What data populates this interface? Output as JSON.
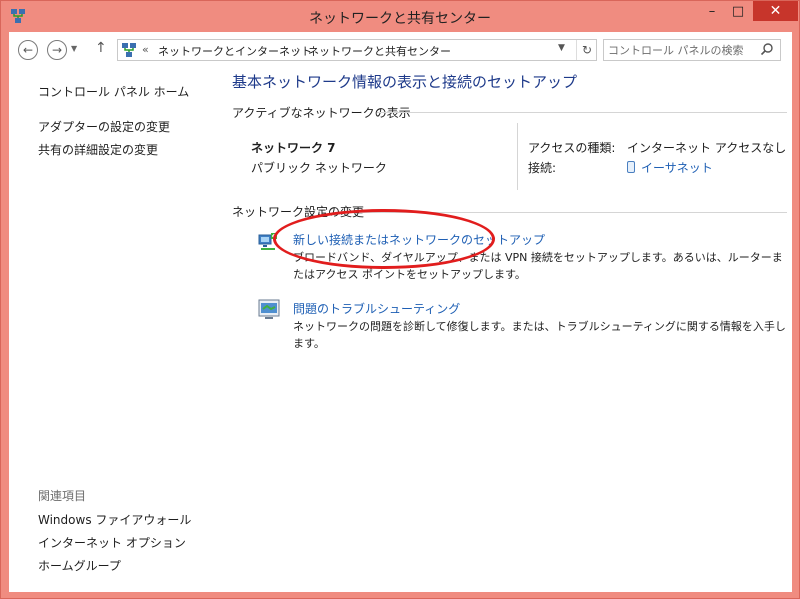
{
  "window": {
    "title": "ネットワークと共有センター",
    "controls": {
      "minimize": "–",
      "maximize": "□",
      "close": "✕"
    }
  },
  "nav": {
    "back_glyph": "←",
    "forward_glyph": "→",
    "up_glyph": "↑",
    "breadcrumb_prefix": "«",
    "breadcrumbs": [
      "ネットワークとインターネット",
      "ネットワークと共有センター"
    ],
    "breadcrumb_separator": "›",
    "refresh_glyph": "↻",
    "search_placeholder": "コントロール パネルの検索"
  },
  "sidebar": {
    "home": "コントロール パネル ホーム",
    "links": [
      "アダプターの設定の変更",
      "共有の詳細設定の変更"
    ],
    "related_heading": "関連項目",
    "related": [
      "Windows ファイアウォール",
      "インターネット オプション",
      "ホームグループ"
    ]
  },
  "main": {
    "title": "基本ネットワーク情報の表示と接続のセットアップ",
    "active_section": "アクティブなネットワークの表示",
    "network": {
      "name": "ネットワーク 7",
      "category": "パブリック ネットワーク",
      "access_label": "アクセスの種類:",
      "access_value": "インターネット アクセスなし",
      "connection_label": "接続:",
      "connection_value": "イーサネット"
    },
    "change_section": "ネットワーク設定の変更",
    "tasks": [
      {
        "icon": "new-connection-icon",
        "title": "新しい接続またはネットワークのセットアップ",
        "desc": "ブロードバンド、ダイヤルアップ、または VPN 接続をセットアップします。あるいは、ルーターまたはアクセス ポイントをセットアップします。"
      },
      {
        "icon": "troubleshoot-icon",
        "title": "問題のトラブルシューティング",
        "desc": "ネットワークの問題を診断して修復します。または、トラブルシューティングに関する情報を入手します。"
      }
    ]
  },
  "colors": {
    "window_frame": "#f08c80",
    "link": "#1e5fb4",
    "title": "#1e3a8a",
    "annotation": "#e11d1d"
  }
}
